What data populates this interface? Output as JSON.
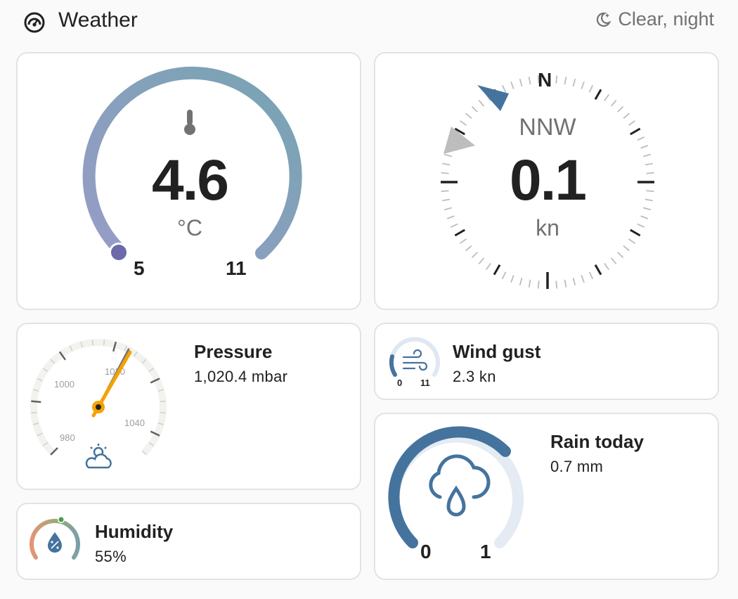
{
  "header": {
    "title": "Weather",
    "status": "Clear, night",
    "icon": "gauge-icon",
    "status_icon": "moon-star-icon"
  },
  "temperature": {
    "value": "4.6",
    "unit": "°C",
    "min": "5",
    "max": "11",
    "icon": "thermometer-icon"
  },
  "wind": {
    "direction": "NNW",
    "speed": "0.1",
    "unit": "kn",
    "compass_north": "N"
  },
  "pressure": {
    "name": "Pressure",
    "state": "1,020.4 mbar",
    "ticks": [
      "980",
      "1000",
      "1020",
      "1040"
    ],
    "icon": "partly-cloudy-icon"
  },
  "wind_gust": {
    "name": "Wind gust",
    "state": "2.3 kn",
    "min": "0",
    "max": "11",
    "icon": "wind-icon"
  },
  "rain": {
    "name": "Rain today",
    "state": "0.7 mm",
    "min": "0",
    "max": "1",
    "icon": "rain-cloud-icon"
  },
  "humidity": {
    "name": "Humidity",
    "state": "55%",
    "icon": "humidity-icon"
  },
  "colors": {
    "accent": "#44739e",
    "pressure_needle": "#f5a200",
    "text_secondary": "#727272"
  }
}
